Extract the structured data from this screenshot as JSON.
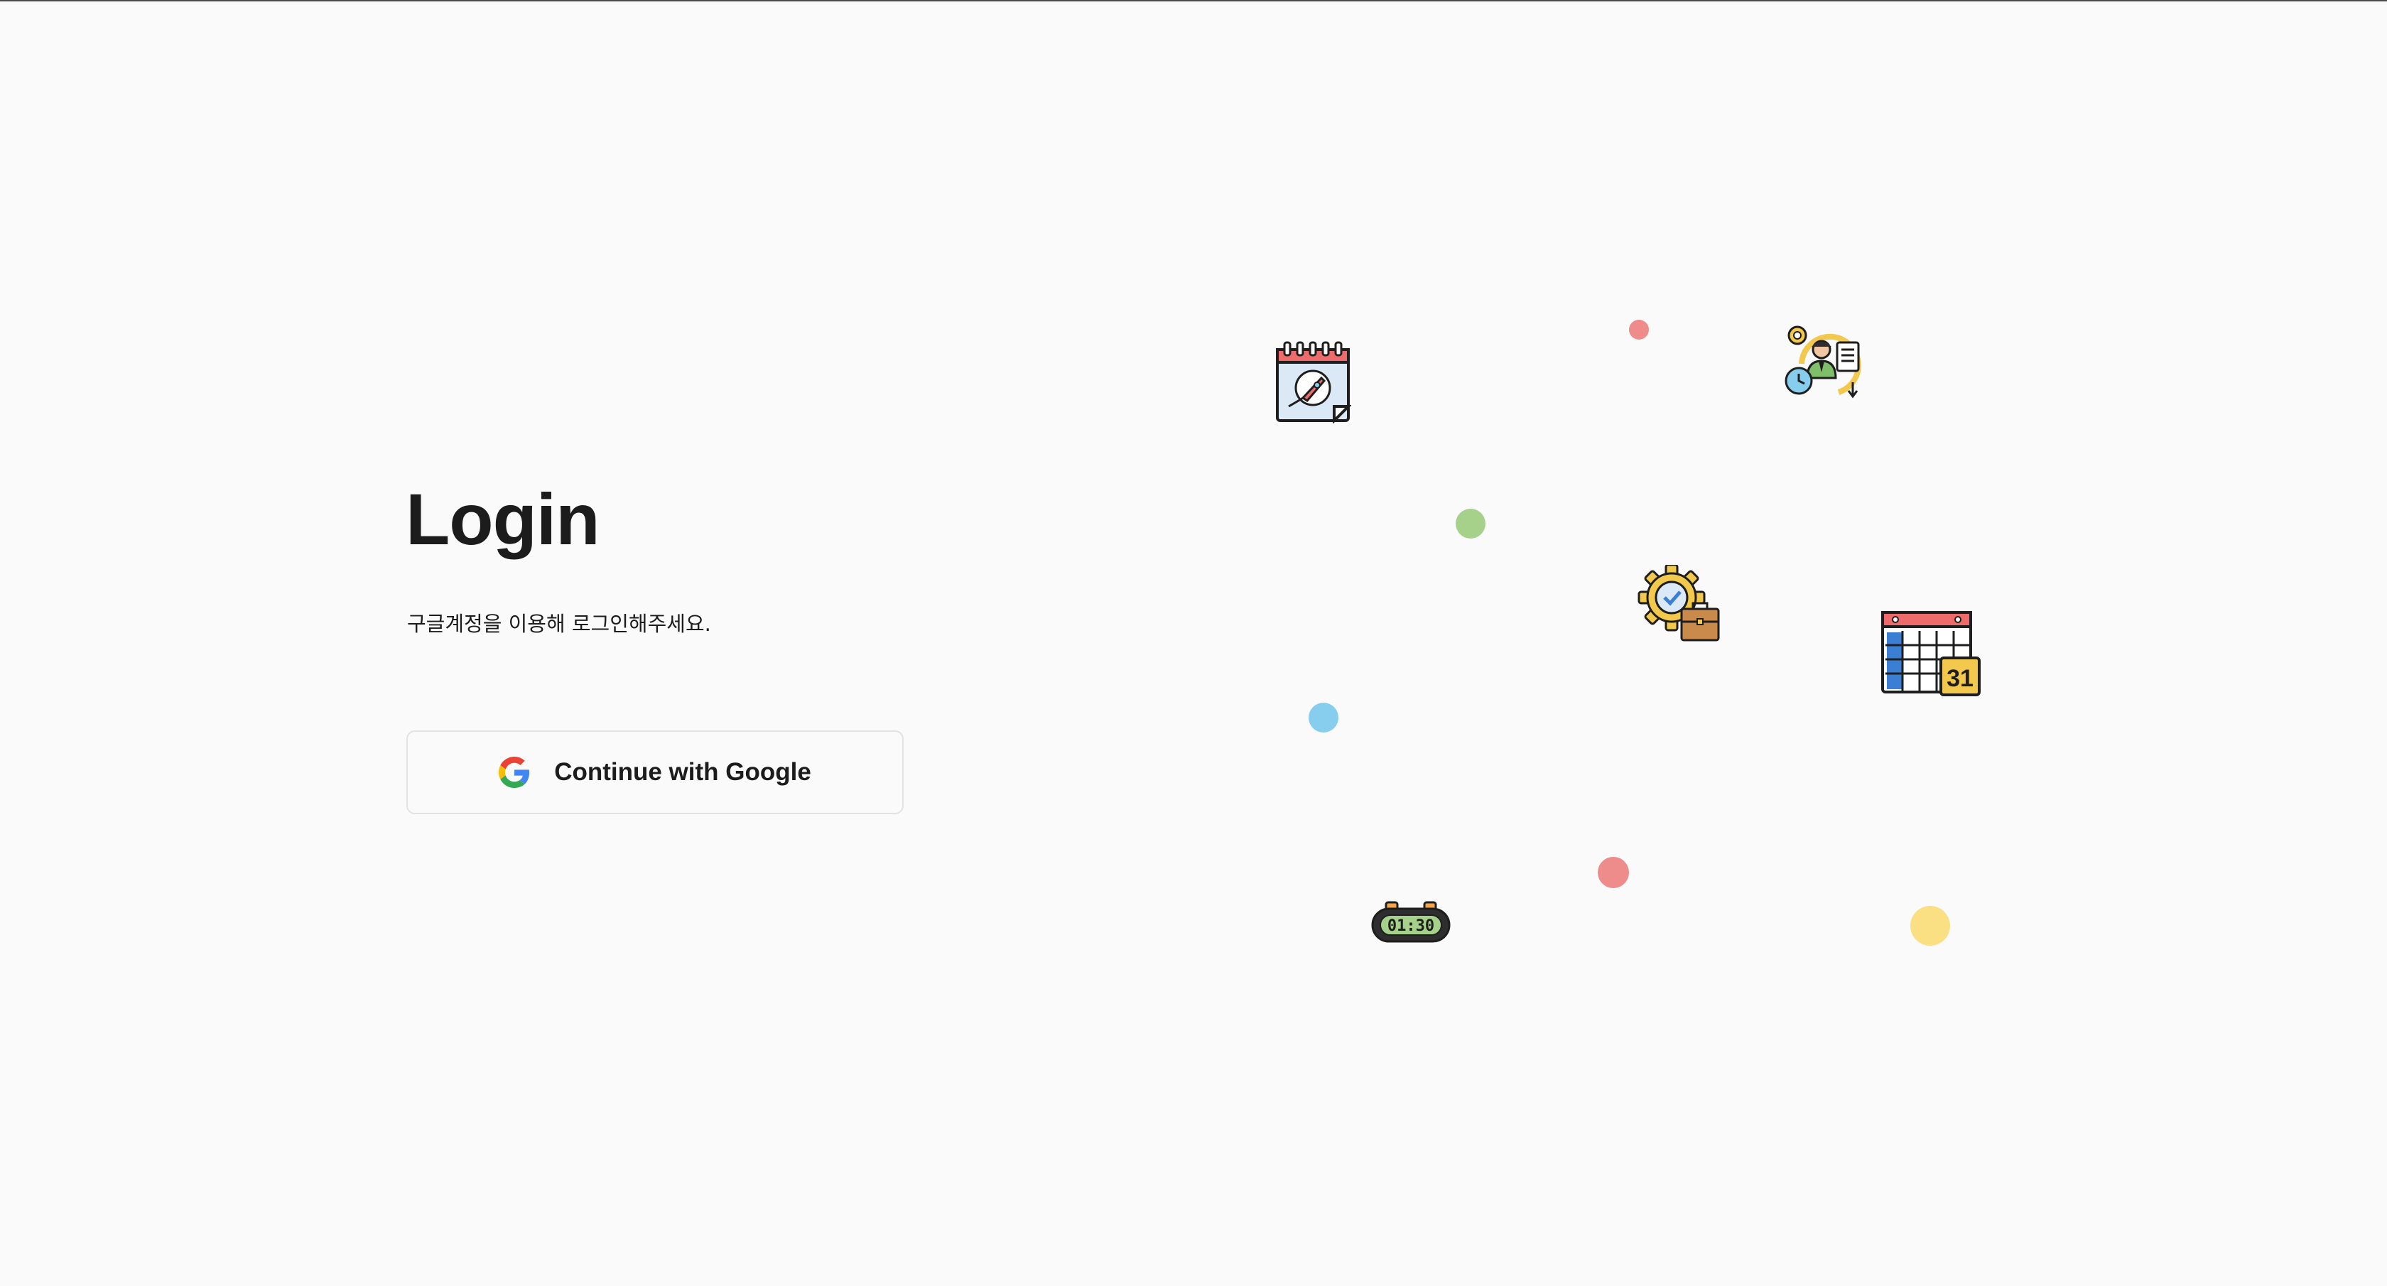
{
  "login": {
    "title": "Login",
    "subtitle": "구글계정을 이용해 로그인해주세요.",
    "google_button_label": "Continue with Google"
  },
  "illustration": {
    "timer_display": "01:30",
    "calendar_day": "31",
    "icons": [
      "rocket-calendar-icon",
      "workflow-person-icon",
      "gear-briefcase-icon",
      "table-calendar-icon",
      "digital-timer-icon"
    ],
    "dot_colors": {
      "red": "#ee8b8b",
      "green": "#a6d18b",
      "blue": "#86cdee",
      "yellow": "#fae083"
    }
  },
  "google_colors": {
    "blue": "#4285F4",
    "red": "#EA4335",
    "yellow": "#FBBC05",
    "green": "#34A853"
  }
}
